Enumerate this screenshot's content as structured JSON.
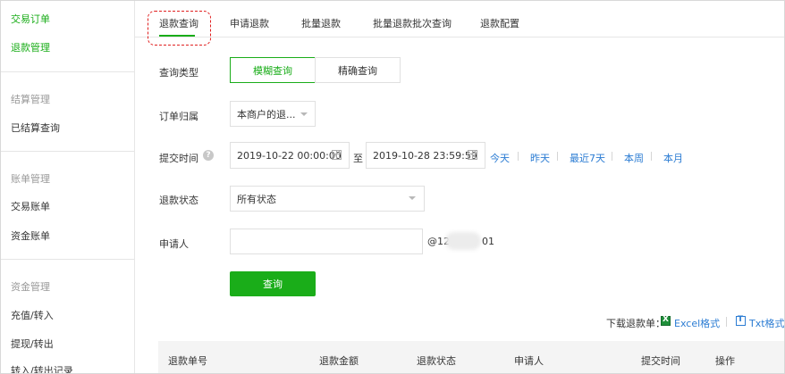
{
  "sidebar": {
    "items": [
      {
        "label": "交易订单",
        "kind": "active"
      },
      {
        "label": "退款管理",
        "kind": "active"
      },
      {
        "label": "结算管理",
        "kind": "group"
      },
      {
        "label": "已结算查询",
        "kind": "link"
      },
      {
        "label": "账单管理",
        "kind": "group"
      },
      {
        "label": "交易账单",
        "kind": "link"
      },
      {
        "label": "资金账单",
        "kind": "link"
      },
      {
        "label": "资金管理",
        "kind": "group"
      },
      {
        "label": "充值/转入",
        "kind": "link"
      },
      {
        "label": "提现/转出",
        "kind": "link"
      },
      {
        "label": "转入/转出记录",
        "kind": "link"
      }
    ]
  },
  "tabs": [
    {
      "label": "退款查询",
      "active": true
    },
    {
      "label": "申请退款",
      "active": false
    },
    {
      "label": "批量退款",
      "active": false
    },
    {
      "label": "批量退款批次查询",
      "active": false
    },
    {
      "label": "退款配置",
      "active": false
    }
  ],
  "form": {
    "query_type": {
      "label": "查询类型",
      "options": [
        "模糊查询",
        "精确查询"
      ],
      "selected": "模糊查询"
    },
    "order_owner": {
      "label": "订单归属",
      "value": "本商户的退..."
    },
    "submit_time": {
      "label": "提交时间",
      "start": "2019-10-22 00:00:00",
      "separator": "至",
      "end": "2019-10-28 23:59:59",
      "quick": [
        "今天",
        "昨天",
        "最近7天",
        "本周",
        "本月"
      ]
    },
    "refund_status": {
      "label": "退款状态",
      "value": "所有状态"
    },
    "applicant": {
      "label": "申请人",
      "value": "",
      "suffix_start": "@12",
      "suffix_end": "01"
    },
    "query_button": "查询"
  },
  "download": {
    "label": "下载退款单：",
    "excel": "Excel格式",
    "txt": "Txt格式"
  },
  "table": {
    "columns": [
      "退款单号",
      "退款金额",
      "退款状态",
      "申请人",
      "提交时间",
      "操作"
    ]
  },
  "colors": {
    "accent": "#1aad19",
    "link": "#2b7cd3",
    "highlight": "#e02020"
  }
}
